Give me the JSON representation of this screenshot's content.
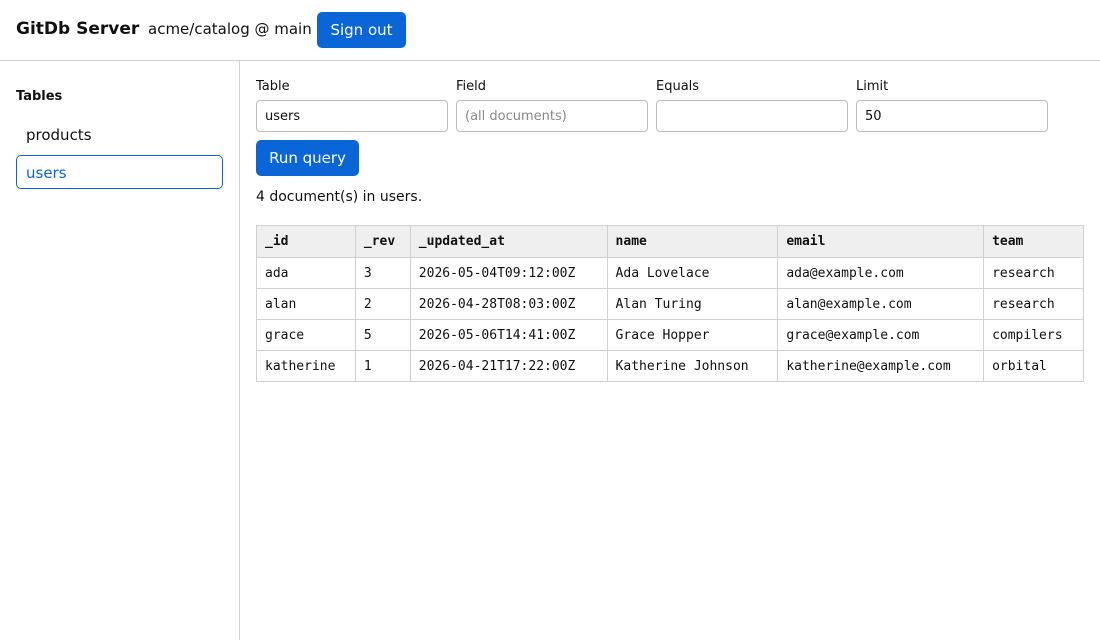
{
  "header": {
    "brand": "GitDb Server",
    "repo": "acme/catalog @ main",
    "sign_out_label": "Sign out"
  },
  "sidebar": {
    "heading": "Tables",
    "items": [
      {
        "label": "products",
        "active": false
      },
      {
        "label": "users",
        "active": true
      }
    ]
  },
  "query": {
    "table": {
      "label": "Table",
      "value": "users",
      "placeholder": ""
    },
    "field": {
      "label": "Field",
      "value": "",
      "placeholder": "(all documents)"
    },
    "equals": {
      "label": "Equals",
      "value": "",
      "placeholder": ""
    },
    "limit": {
      "label": "Limit",
      "value": "50",
      "placeholder": ""
    },
    "run_label": "Run query"
  },
  "results": {
    "summary": "4 document(s) in users.",
    "columns": [
      "_id",
      "_rev",
      "_updated_at",
      "name",
      "email",
      "team"
    ],
    "rows": [
      [
        "ada",
        "3",
        "2026-05-04T09:12:00Z",
        "Ada Lovelace",
        "ada@example.com",
        "research"
      ],
      [
        "alan",
        "2",
        "2026-04-28T08:03:00Z",
        "Alan Turing",
        "alan@example.com",
        "research"
      ],
      [
        "grace",
        "5",
        "2026-05-06T14:41:00Z",
        "Grace Hopper",
        "grace@example.com",
        "compilers"
      ],
      [
        "katherine",
        "1",
        "2026-04-21T17:22:00Z",
        "Katherine Johnson",
        "katherine@example.com",
        "orbital"
      ]
    ]
  },
  "colors": {
    "accent": "#0a66d6",
    "border": "#d0d0d0",
    "header_bg": "#efefef"
  }
}
